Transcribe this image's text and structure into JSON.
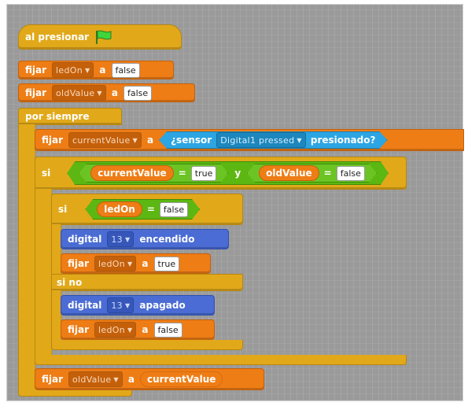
{
  "hat": {
    "label": "al presionar"
  },
  "init1": {
    "verb": "fijar",
    "var": "ledOn",
    "prep": "a",
    "value": "false"
  },
  "init2": {
    "verb": "fijar",
    "var": "oldValue",
    "prep": "a",
    "value": "false"
  },
  "loop": {
    "label": "por siempre"
  },
  "setCurrent": {
    "verb": "fijar",
    "var": "currentValue",
    "prep": "a",
    "sensor": {
      "prefix": "¿sensor",
      "name": "Digital1 pressed",
      "suffix": "presionado?"
    }
  },
  "ifOuter": {
    "keyword": "si",
    "lhs": {
      "var": "currentValue",
      "op": "=",
      "value": "true"
    },
    "and": "y",
    "rhs": {
      "var": "oldValue",
      "op": "=",
      "value": "false"
    }
  },
  "ifInner": {
    "keyword": "si",
    "cond": {
      "var": "ledOn",
      "op": "=",
      "value": "false"
    },
    "else": "si no"
  },
  "digitalOn": {
    "label": "digital",
    "pin": "13",
    "state": "encendido"
  },
  "setLedTrue": {
    "verb": "fijar",
    "var": "ledOn",
    "prep": "a",
    "value": "true"
  },
  "digitalOff": {
    "label": "digital",
    "pin": "13",
    "state": "apagado"
  },
  "setLedFalse": {
    "verb": "fijar",
    "var": "ledOn",
    "prep": "a",
    "value": "false"
  },
  "setOld": {
    "verb": "fijar",
    "var": "oldValue",
    "prep": "a",
    "value_var": "currentValue"
  },
  "colors": {
    "control": "#e1a91a",
    "variables": "#ee7d16",
    "io": "#4a6cd4",
    "sensing": "#2ca5e2",
    "operators": "#5cb712",
    "flag": "#3fd63b"
  }
}
